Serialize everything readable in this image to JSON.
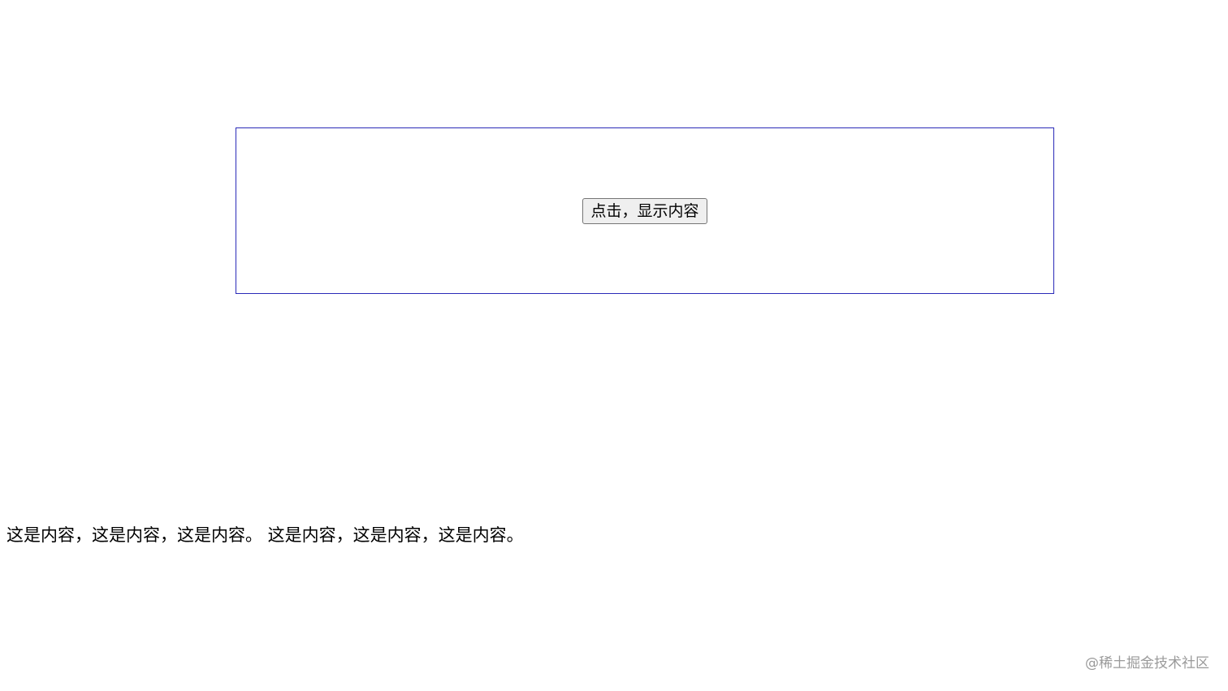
{
  "overlay": {
    "border_color": "#2a2ab8",
    "button_label": "点击，显示内容"
  },
  "content": {
    "text": "这是内容，这是内容，这是内容。 这是内容，这是内容，这是内容。"
  },
  "watermark": {
    "text": "@稀土掘金技术社区"
  }
}
